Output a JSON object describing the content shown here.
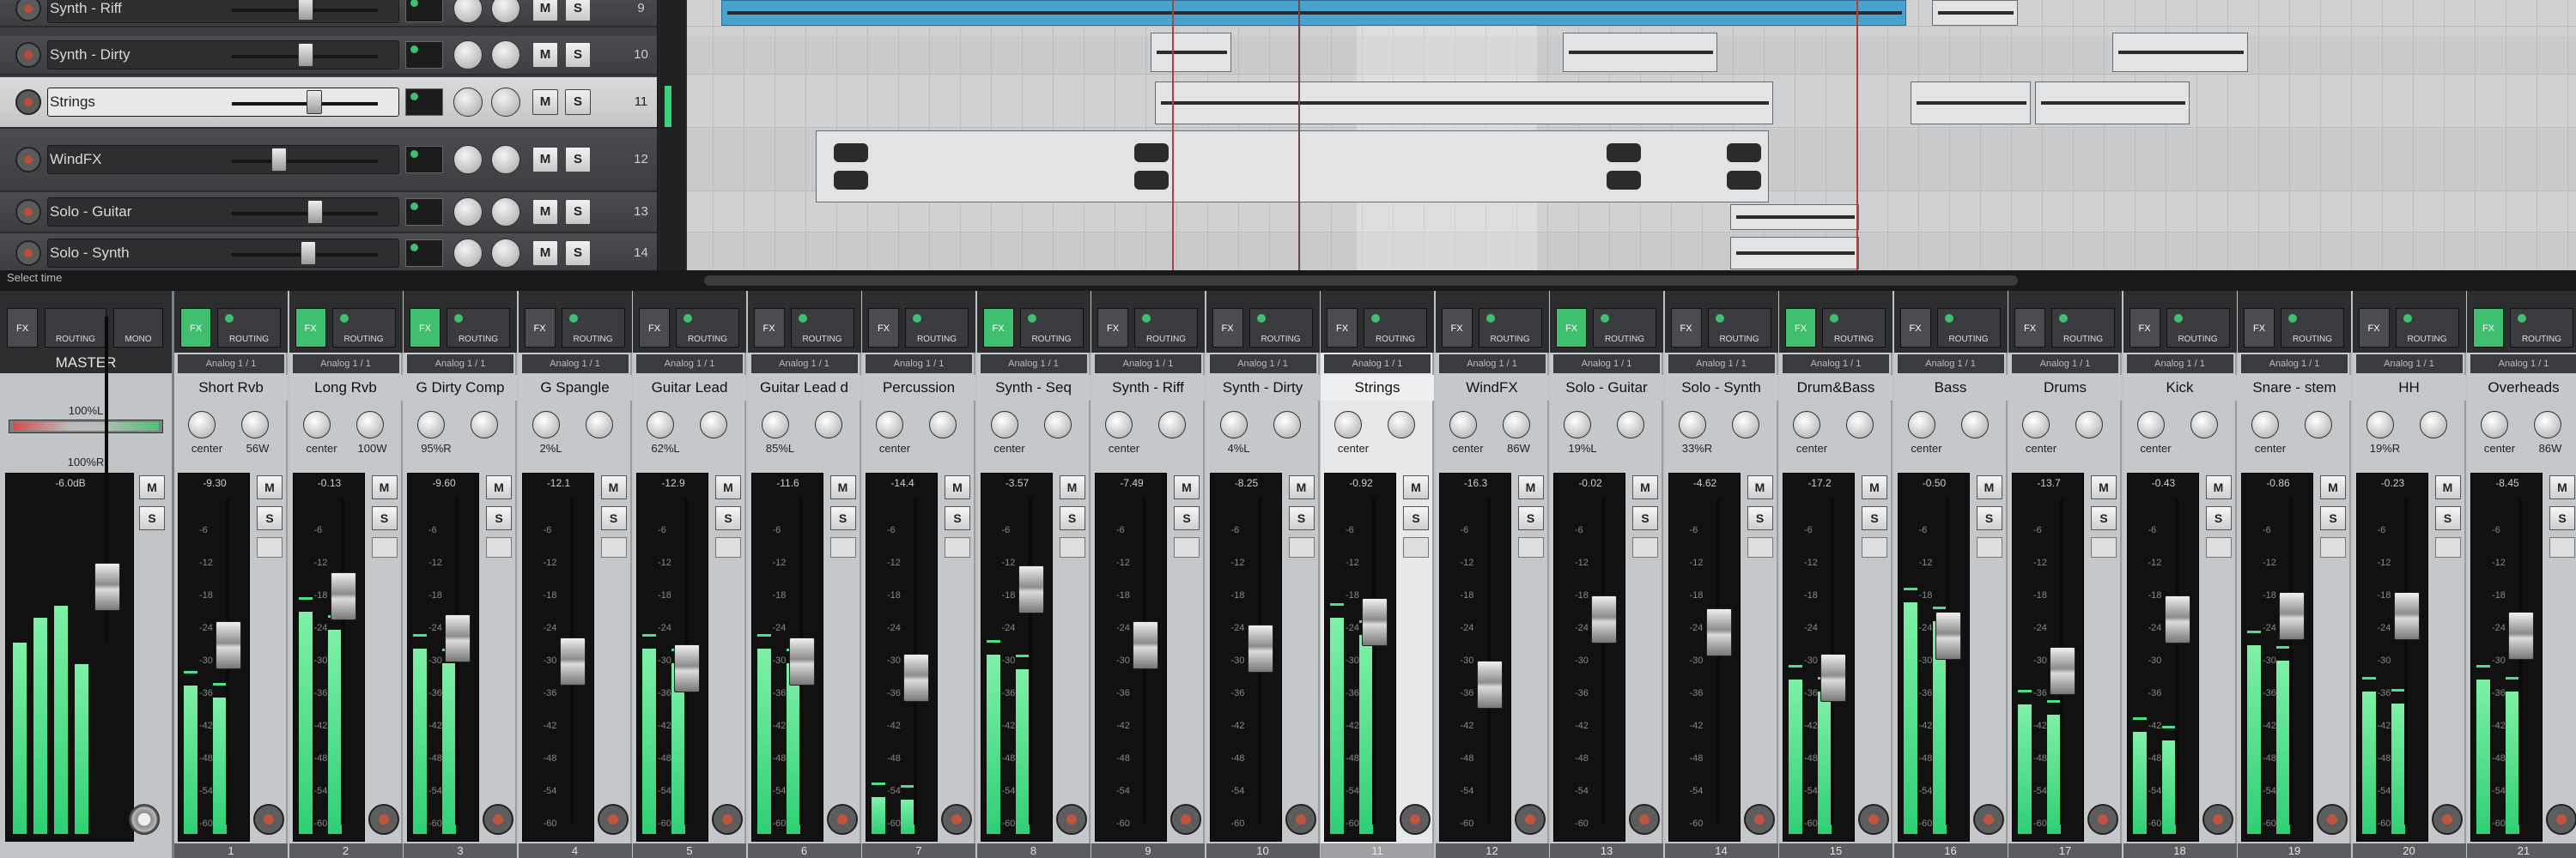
{
  "tracks": [
    {
      "label": "Synth - Riff",
      "num": "9"
    },
    {
      "label": "Synth - Dirty",
      "num": "10"
    },
    {
      "label": "Strings",
      "num": "11",
      "selected": true
    },
    {
      "label": "WindFX",
      "num": "12"
    },
    {
      "label": "Solo - Guitar",
      "num": "13"
    },
    {
      "label": "Solo - Synth",
      "num": "14"
    }
  ],
  "track_buttons": {
    "mute": "M",
    "solo": "S"
  },
  "divider": {
    "status": "Select time"
  },
  "master": {
    "name": "MASTER",
    "fx": "FX",
    "routing": "ROUTING",
    "mono": "MONO",
    "balance_l": "100%L",
    "balance_r": "100%R",
    "peak_db": "-6.0dB",
    "mute": "M",
    "solo": "S",
    "levels": [
      0.62,
      0.7,
      0.74,
      0.55
    ]
  },
  "strip_buttons": {
    "fx": "FX",
    "routing": "ROUTING",
    "mute": "M",
    "solo": "S",
    "input": "Analog 1 / 1"
  },
  "channels": [
    {
      "name": "Short Rvb",
      "pan": "center",
      "width": "56W",
      "db": "-9.30",
      "num": "1",
      "level": 0.48,
      "fader": 0.55,
      "fx": true
    },
    {
      "name": "Long Rvb",
      "pan": "center",
      "width": "100W",
      "db": "-0.13",
      "num": "2",
      "level": 0.72,
      "fader": 0.7,
      "fx": true
    },
    {
      "name": "G Dirty Comp",
      "pan": "95%R",
      "width": "",
      "db": "-9.60",
      "num": "3",
      "level": 0.6,
      "fader": 0.57,
      "fx": true
    },
    {
      "name": "G Spangle",
      "pan": "2%L",
      "width": "",
      "db": "-12.1",
      "num": "4",
      "level": 0.0,
      "fader": 0.5,
      "fx": false
    },
    {
      "name": "Guitar Lead",
      "pan": "62%L",
      "width": "",
      "db": "-12.9",
      "num": "5",
      "level": 0.6,
      "fader": 0.48,
      "fx": false
    },
    {
      "name": "Guitar Lead d",
      "pan": "85%L",
      "width": "",
      "db": "-11.6",
      "num": "6",
      "level": 0.6,
      "fader": 0.5,
      "fx": false
    },
    {
      "name": "Percussion",
      "pan": "center",
      "width": "",
      "db": "-14.4",
      "num": "7",
      "level": 0.12,
      "fader": 0.45,
      "fx": false
    },
    {
      "name": "Synth - Seq",
      "pan": "center",
      "width": "",
      "db": "-3.57",
      "num": "8",
      "level": 0.58,
      "fader": 0.72,
      "fx": true
    },
    {
      "name": "Synth - Riff",
      "pan": "center",
      "width": "",
      "db": "-7.49",
      "num": "9",
      "level": 0.0,
      "fader": 0.55,
      "fx": false
    },
    {
      "name": "Synth - Dirty",
      "pan": "4%L",
      "width": "",
      "db": "-8.25",
      "num": "10",
      "level": 0.0,
      "fader": 0.54,
      "fx": false
    },
    {
      "name": "Strings",
      "pan": "center",
      "width": "",
      "db": "-0.92",
      "num": "11",
      "level": 0.7,
      "fader": 0.62,
      "fx": false,
      "selected": true
    },
    {
      "name": "WindFX",
      "pan": "center",
      "width": "86W",
      "db": "-16.3",
      "num": "12",
      "level": 0.0,
      "fader": 0.43,
      "fx": false
    },
    {
      "name": "Solo - Guitar",
      "pan": "19%L",
      "width": "",
      "db": "-0.02",
      "num": "13",
      "level": 0.0,
      "fader": 0.63,
      "fx": true
    },
    {
      "name": "Solo - Synth",
      "pan": "33%R",
      "width": "",
      "db": "-4.62",
      "num": "14",
      "level": 0.0,
      "fader": 0.59,
      "fx": false
    },
    {
      "name": "Drum&Bass",
      "pan": "center",
      "width": "",
      "db": "-17.2",
      "num": "15",
      "level": 0.5,
      "fader": 0.45,
      "fx": true
    },
    {
      "name": "Bass",
      "pan": "center",
      "width": "",
      "db": "-0.50",
      "num": "16",
      "level": 0.75,
      "fader": 0.58,
      "fx": false
    },
    {
      "name": "Drums",
      "pan": "center",
      "width": "",
      "db": "-13.7",
      "num": "17",
      "level": 0.42,
      "fader": 0.47,
      "fx": false
    },
    {
      "name": "Kick",
      "pan": "center",
      "width": "",
      "db": "-0.43",
      "num": "18",
      "level": 0.33,
      "fader": 0.63,
      "fx": false
    },
    {
      "name": "Snare - stem",
      "pan": "center",
      "width": "",
      "db": "-0.86",
      "num": "19",
      "level": 0.61,
      "fader": 0.64,
      "fx": false
    },
    {
      "name": "HH",
      "pan": "19%R",
      "width": "",
      "db": "-0.23",
      "num": "20",
      "level": 0.46,
      "fader": 0.64,
      "fx": false
    },
    {
      "name": "Overheads",
      "pan": "center",
      "width": "86W",
      "db": "-8.45",
      "num": "21",
      "level": 0.5,
      "fader": 0.58,
      "fx": true
    }
  ],
  "colors": {
    "meter": "#2fcf74",
    "item_blue": "#4aa2cf",
    "edit_cursor": "#c0392b",
    "selected_strip": "#e7e8e9"
  }
}
